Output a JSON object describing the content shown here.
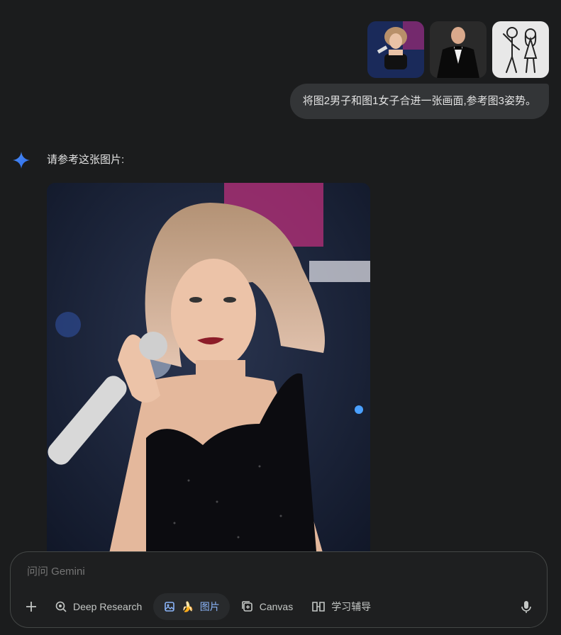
{
  "user_message": {
    "attachments": [
      {
        "icon": "woman-singer-photo"
      },
      {
        "icon": "man-tuxedo-photo"
      },
      {
        "icon": "stick-figure-couple-drawing"
      }
    ],
    "text": "将图2男子和图1女子合进一张画面,参考图3姿势。"
  },
  "assistant": {
    "icon": "gemini-sparkle-icon",
    "text": "请参考这张图片:",
    "image": {
      "icon": "generated-singer-image"
    }
  },
  "input": {
    "placeholder": "问问 Gemini",
    "tools": [
      {
        "label": "Deep Research",
        "icon": "deep-research-icon"
      },
      {
        "label": "图片",
        "emoji": "🍌",
        "icon": "image-gen-icon",
        "active": true
      },
      {
        "label": "Canvas",
        "icon": "canvas-icon"
      },
      {
        "label": "学习辅导",
        "icon": "book-icon"
      }
    ]
  },
  "colors": {
    "background": "#1b1c1d",
    "bubble": "#333537",
    "accent": "#8ab4f8",
    "text": "#e3e3e3"
  }
}
